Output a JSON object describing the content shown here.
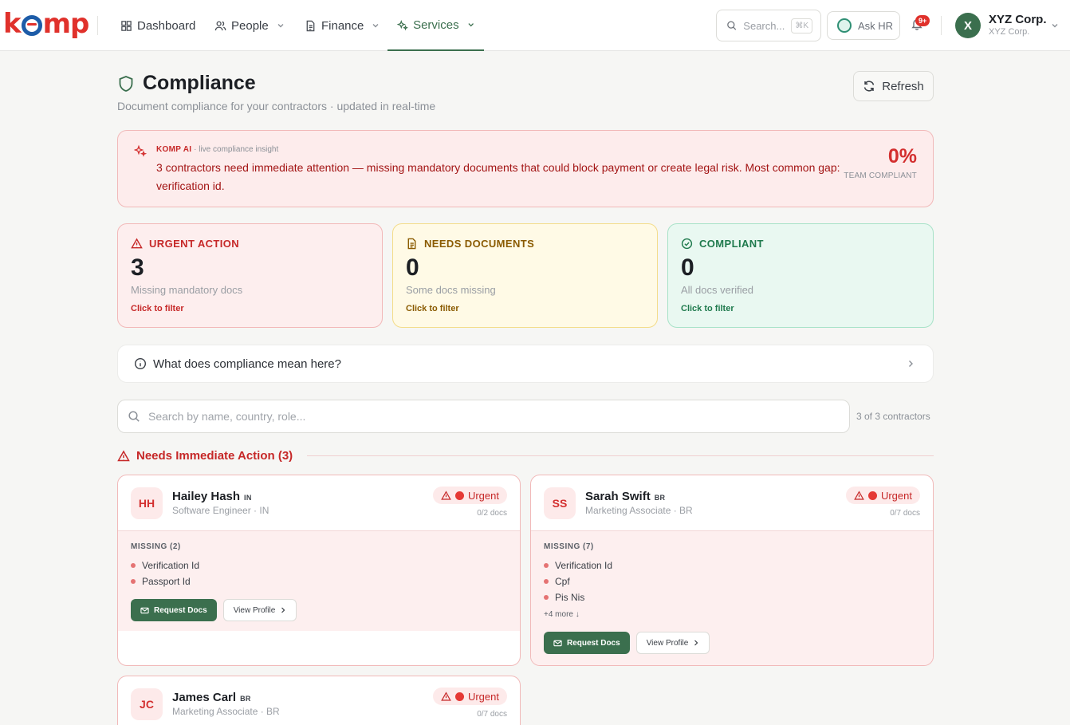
{
  "brand": {
    "logo_text": "komp"
  },
  "nav": {
    "items": [
      {
        "label": "Dashboard",
        "icon": "grid-icon"
      },
      {
        "label": "People",
        "icon": "users-icon"
      },
      {
        "label": "Finance",
        "icon": "document-icon"
      },
      {
        "label": "Services",
        "icon": "sparkles-icon",
        "active": true
      }
    ],
    "search_placeholder": "Search...",
    "search_shortcut": "⌘K",
    "ask_hr": "Ask HR",
    "notification_badge": "9+",
    "user": {
      "initial": "X",
      "name": "XYZ Corp.",
      "org": "XYZ Corp."
    }
  },
  "page": {
    "title": "Compliance",
    "subtitle": "Document compliance for your contractors · updated in real-time",
    "refresh_label": "Refresh"
  },
  "ai_insight": {
    "label": "KOMP AI",
    "tag": "· live compliance insight",
    "text": "3 contractors need immediate attention — missing mandatory documents that could block payment or create legal risk. Most common gap: verification id.",
    "percent": "0%",
    "percent_label": "TEAM COMPLIANT"
  },
  "stats": [
    {
      "label": "URGENT ACTION",
      "value": "3",
      "desc": "Missing mandatory docs",
      "cta": "Click to filter"
    },
    {
      "label": "NEEDS DOCUMENTS",
      "value": "0",
      "desc": "Some docs missing",
      "cta": "Click to filter"
    },
    {
      "label": "COMPLIANT",
      "value": "0",
      "desc": "All docs verified",
      "cta": "Click to filter"
    }
  ],
  "explainer": {
    "label": "What does compliance mean here?"
  },
  "contractor_search": {
    "placeholder": "Search by name, country, role...",
    "count": "3 of 3 contractors"
  },
  "section": {
    "title": "Needs Immediate Action (3)"
  },
  "contractors": [
    {
      "initials": "HH",
      "name": "Hailey Hash",
      "country": "IN",
      "role": "Software Engineer · IN",
      "status": "Urgent",
      "docs": "0/2 docs",
      "missing_title": "MISSING (2)",
      "missing": [
        "Verification Id",
        "Passport Id"
      ],
      "more": "",
      "request_label": "Request Docs",
      "view_label": "View Profile"
    },
    {
      "initials": "SS",
      "name": "Sarah Swift",
      "country": "BR",
      "role": "Marketing Associate · BR",
      "status": "Urgent",
      "docs": "0/7 docs",
      "missing_title": "MISSING (7)",
      "missing": [
        "Verification Id",
        "Cpf",
        "Pis Nis"
      ],
      "more": "+4 more ↓",
      "request_label": "Request Docs",
      "view_label": "View Profile"
    },
    {
      "initials": "JC",
      "name": "James Carl",
      "country": "BR",
      "role": "Marketing Associate · BR",
      "status": "Urgent",
      "docs": "0/7 docs"
    }
  ],
  "colors": {
    "brand_red": "#e0312b",
    "brand_green": "#3b6f4e",
    "urgent": "#c62828",
    "warning": "#8a5a00",
    "success": "#1f7a4d"
  }
}
